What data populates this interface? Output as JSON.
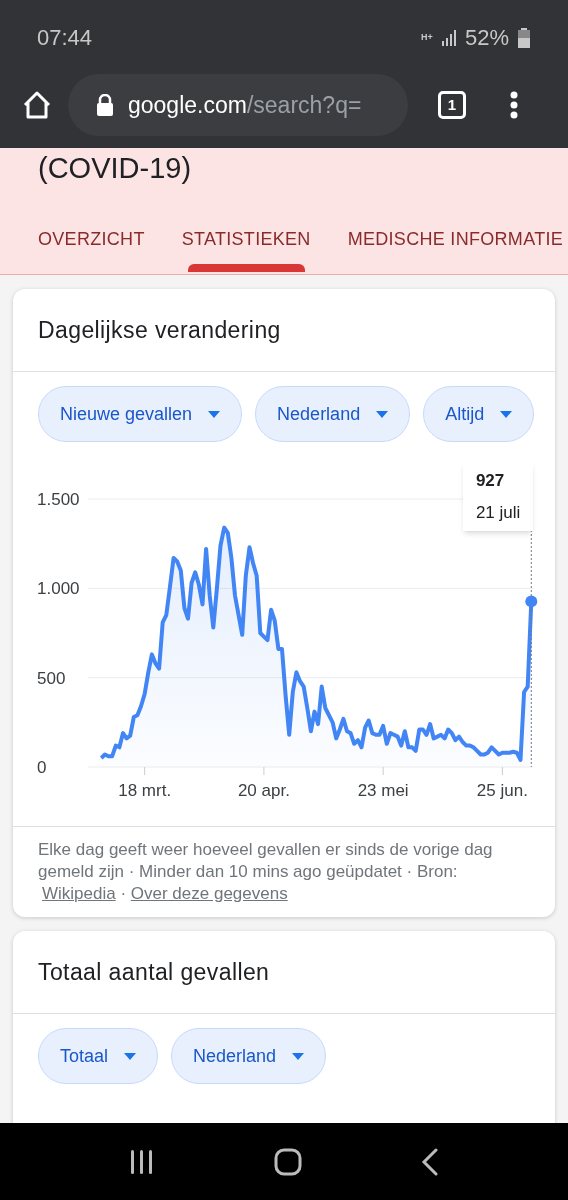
{
  "status_bar": {
    "time": "07:44",
    "network": "H+",
    "battery": "52%"
  },
  "browser": {
    "domain": "google.com",
    "path": "/search?q=",
    "tab_count": "1"
  },
  "header": {
    "title": "(COVID-19)"
  },
  "tabs": [
    {
      "label": "OVERZICHT",
      "selected": false
    },
    {
      "label": "STATISTIEKEN",
      "selected": true
    },
    {
      "label": "MEDISCHE INFORMATIE",
      "selected": false
    }
  ],
  "cards": [
    {
      "title": "Dagelijkse verandering",
      "filters": [
        "Nieuwe gevallen",
        "Nederland",
        "Altijd"
      ],
      "chart_data": {
        "type": "area",
        "categories": [
          null,
          null,
          null,
          null,
          null,
          null,
          null,
          null,
          null,
          null,
          null,
          null,
          "18 mrt.",
          null,
          null,
          null,
          null,
          null,
          null,
          null,
          null,
          null,
          null,
          null,
          null,
          null,
          null,
          null,
          null,
          null,
          null,
          null,
          null,
          null,
          null,
          null,
          null,
          null,
          null,
          null,
          null,
          null,
          null,
          null,
          null,
          "20 apr.",
          null,
          null,
          null,
          null,
          null,
          null,
          null,
          null,
          null,
          null,
          null,
          null,
          null,
          null,
          null,
          null,
          null,
          null,
          null,
          null,
          null,
          null,
          null,
          null,
          null,
          null,
          null,
          null,
          null,
          null,
          null,
          null,
          "23 mei",
          null,
          null,
          null,
          null,
          null,
          null,
          null,
          null,
          null,
          null,
          null,
          null,
          null,
          null,
          null,
          null,
          null,
          null,
          null,
          null,
          null,
          null,
          null,
          null,
          null,
          null,
          null,
          null,
          null,
          null,
          null,
          null,
          "25 jun.",
          null,
          null,
          null,
          null,
          null,
          null,
          null,
          null
        ],
        "series": [
          {
            "color": "#4285f4",
            "values": [
              50,
              70,
              60,
              60,
              120,
              110,
              190,
              160,
              175,
              280,
              290,
              340,
              410,
              530,
              630,
              580,
              550,
              810,
              850,
              1010,
              1170,
              1150,
              1100,
              890,
              830,
              1030,
              1090,
              1020,
              910,
              1220,
              960,
              780,
              1000,
              1240,
              1340,
              1310,
              1170,
              960,
              850,
              740,
              1070,
              1230,
              1140,
              1070,
              750,
              730,
              710,
              880,
              820,
              660,
              660,
              400,
              180,
              420,
              530,
              480,
              450,
              330,
              200,
              310,
              240,
              450,
              330,
              290,
              250,
              160,
              210,
              270,
              200,
              190,
              130,
              150,
              110,
              220,
              260,
              190,
              180,
              180,
              230,
              130,
              190,
              180,
              170,
              120,
              200,
              110,
              110,
              90,
              210,
              210,
              180,
              240,
              160,
              170,
              180,
              160,
              210,
              190,
              150,
              170,
              140,
              120,
              120,
              110,
              90,
              70,
              70,
              80,
              110,
              90,
              70,
              80,
              80,
              80,
              85,
              80,
              40,
              420,
              450,
              927
            ]
          }
        ],
        "grid": true,
        "ylim": [
          0,
          1500
        ],
        "yticks": [
          {
            "value": 0,
            "label": "0"
          },
          {
            "value": 500,
            "label": "500"
          },
          {
            "value": 1000,
            "label": "1.000"
          },
          {
            "value": 1500,
            "label": "1.500"
          }
        ]
      },
      "tooltip": {
        "value": "927",
        "date": "21 juli"
      },
      "footer": {
        "text": "Elke dag geeft weer hoeveel gevallen er sinds de vorige dag gemeld zijn · Minder dan 10 mins ago geüpdatet",
        "separator": "·",
        "source_label": "Bron:",
        "links": [
          "Wikipedia",
          "Over deze gegevens"
        ]
      }
    },
    {
      "title": "Totaal aantal gevallen",
      "filters": [
        "Totaal",
        "Nederland"
      ]
    }
  ]
}
